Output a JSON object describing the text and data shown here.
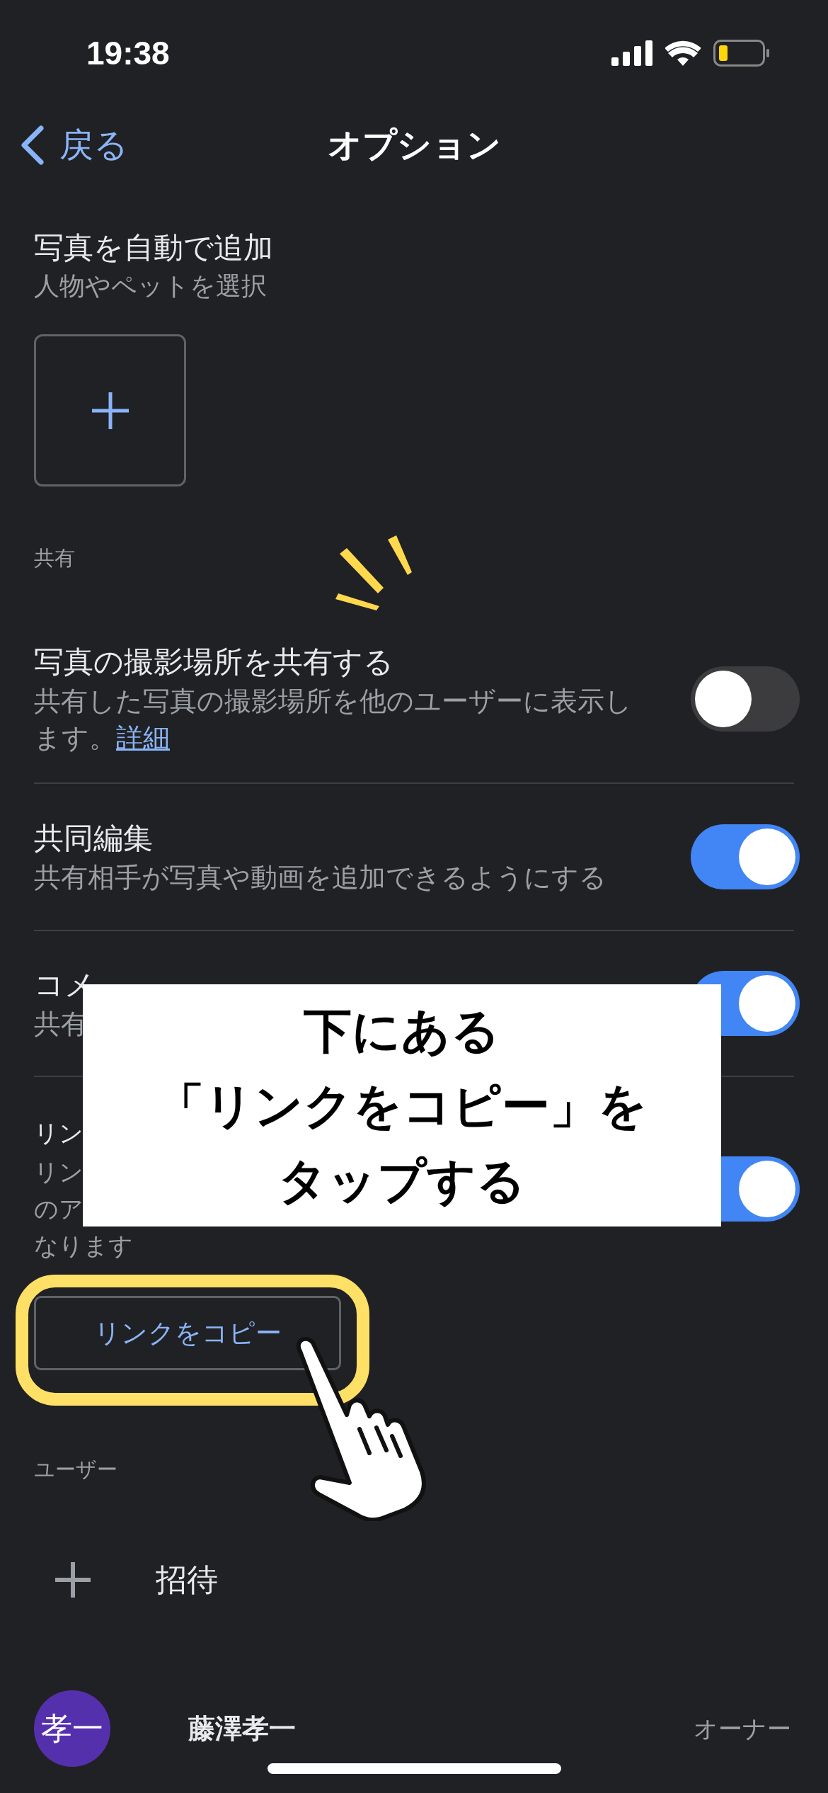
{
  "status_bar": {
    "time": "19:38"
  },
  "nav": {
    "back": "戻る",
    "title": "オプション"
  },
  "auto_add": {
    "title": "写真を自動で追加",
    "subtitle": "人物やペットを選択"
  },
  "sharing": {
    "header": "共有",
    "settings": [
      {
        "title": "写真の撮影場所を共有する",
        "description": [
          "共有した写真の撮影場所を他のユーザーに表示します。"
        ],
        "link": "詳細",
        "on": false
      },
      {
        "title": "共同編集",
        "description": [
          "共有相手が写真や動画を追加できるようにする"
        ],
        "on": true
      },
      {
        "title": "コメ",
        "description": [
          "共有"
        ],
        "on": true
      },
      {
        "title": "リン",
        "description": [
          "リン",
          "のア",
          "なります"
        ],
        "on": true
      }
    ],
    "copy_link_button": "リンクをコピー"
  },
  "callout": {
    "lines": [
      "下にある",
      "「リンクをコピー」を",
      "タップする"
    ]
  },
  "users": {
    "header": "ユーザー",
    "invite": "招待",
    "members": [
      {
        "initials": "孝一",
        "name": "藤澤孝一",
        "role": "オーナー",
        "color": "#5530ad"
      }
    ]
  }
}
